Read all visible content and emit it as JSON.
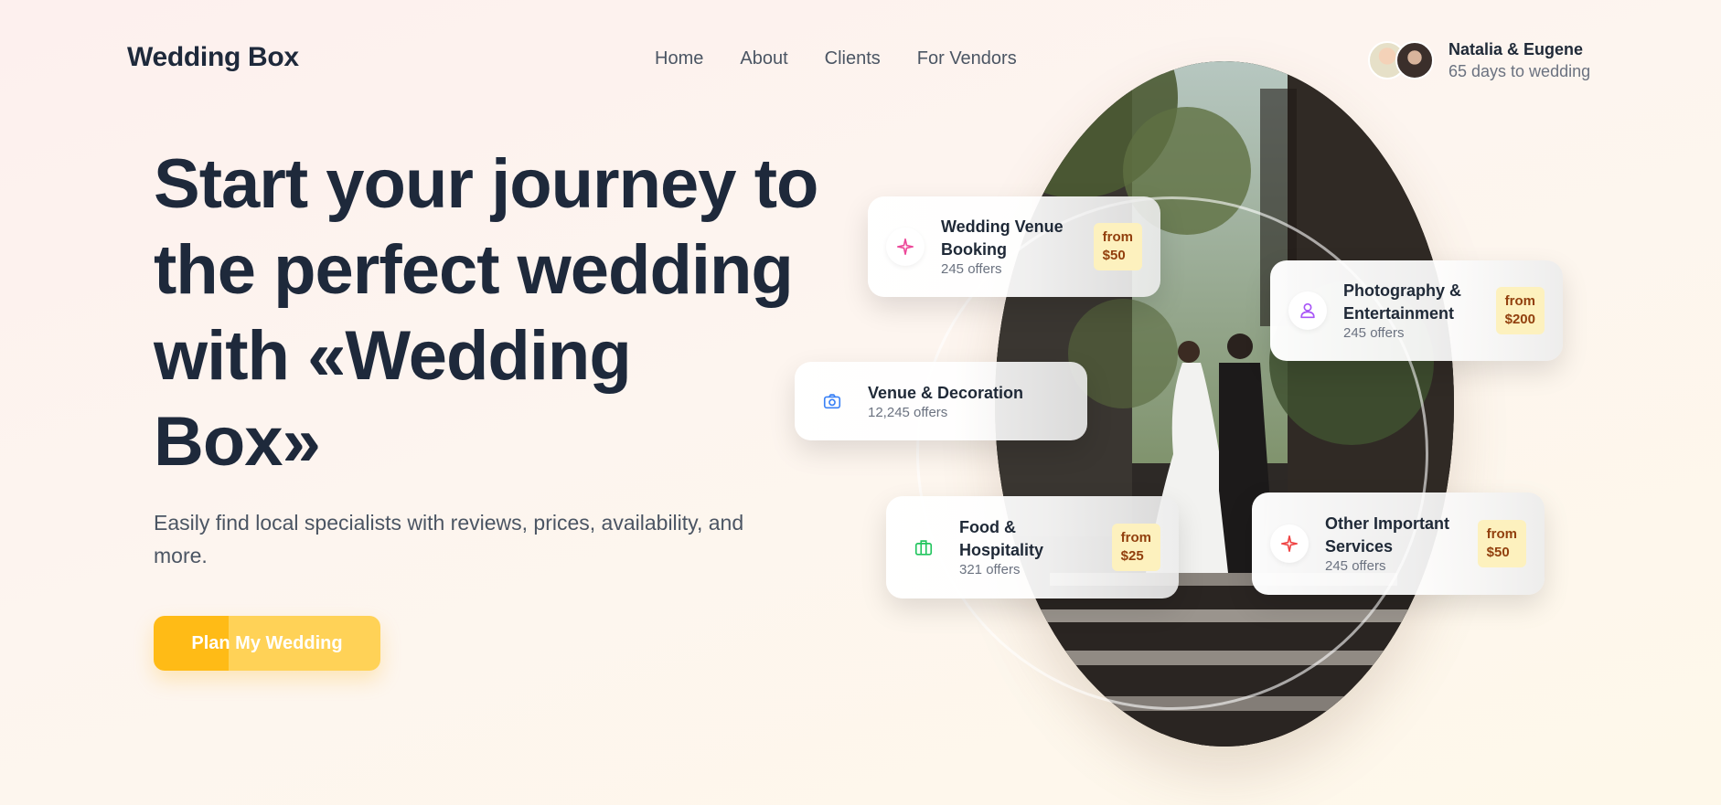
{
  "header": {
    "brand": "Wedding Box",
    "nav": [
      "Home",
      "About",
      "Clients",
      "For Vendors"
    ],
    "couple": {
      "names": "Natalia & Eugene",
      "countdown": "65 days to wedding"
    }
  },
  "hero": {
    "headline_lines": [
      "Start your journey to",
      "the perfect wedding",
      "with «Wedding",
      "Box»"
    ],
    "subtitle_lines": [
      "Easily find local specialists with reviews, prices, availability, and",
      "more."
    ],
    "cta_label": "Plan My Wedding"
  },
  "services": [
    {
      "icon": "sparkle-icon",
      "icon_color": "#ec4899",
      "title_lines": [
        "Wedding Venue",
        "Booking"
      ],
      "offers": "245 offers",
      "price_lines": [
        "from",
        "$50"
      ]
    },
    {
      "icon": "user-icon",
      "icon_color": "#a855f7",
      "title_lines": [
        "Photography &",
        "Entertainment"
      ],
      "offers": "245 offers",
      "price_lines": [
        "from",
        "$200"
      ]
    },
    {
      "icon": "camera-icon",
      "icon_color": "#3b82f6",
      "title_lines": [
        "Venue & Decoration"
      ],
      "offers": "12,245 offers",
      "price_lines": []
    },
    {
      "icon": "briefcase-icon",
      "icon_color": "#22c55e",
      "title_lines": [
        "Food &",
        "Hospitality"
      ],
      "offers": "321 offers",
      "price_lines": [
        "from",
        "$25"
      ]
    },
    {
      "icon": "sparkle-icon",
      "icon_color": "#ef4444",
      "title_lines": [
        "Other Important",
        "Services"
      ],
      "offers": "245 offers",
      "price_lines": [
        "from",
        "$50"
      ]
    }
  ],
  "colors": {
    "accent": "#ffbb16",
    "accent_light": "#ffd257",
    "price_bg": "#fdf1be",
    "heading": "#1e293b"
  }
}
